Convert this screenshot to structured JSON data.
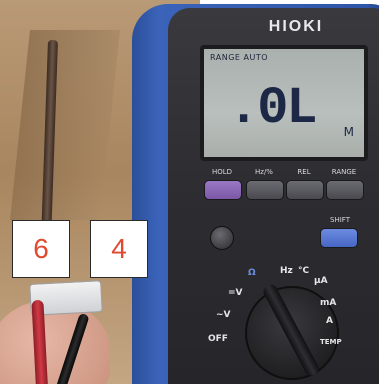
{
  "meter": {
    "brand": "HIOKI",
    "lcd": {
      "mode_text": "RANGE AUTO",
      "value": ".0L",
      "unit": "M"
    },
    "buttons": {
      "hold": "HOLD",
      "hz_percent": "Hz/%",
      "rel": "REL",
      "range": "RANGE",
      "shift": "SHIFT"
    },
    "dial": {
      "labels": [
        "OFF",
        "~V",
        "=V",
        "Ω",
        "Hz",
        "°C",
        "μA",
        "mA",
        "A",
        "TEMP"
      ]
    }
  },
  "overlays": {
    "label_left": "6",
    "label_right": "4"
  },
  "colors": {
    "meter_blue": "#2e55a7",
    "label_text": "#e04a2e",
    "lcd_bg": "#b9bfbc"
  }
}
